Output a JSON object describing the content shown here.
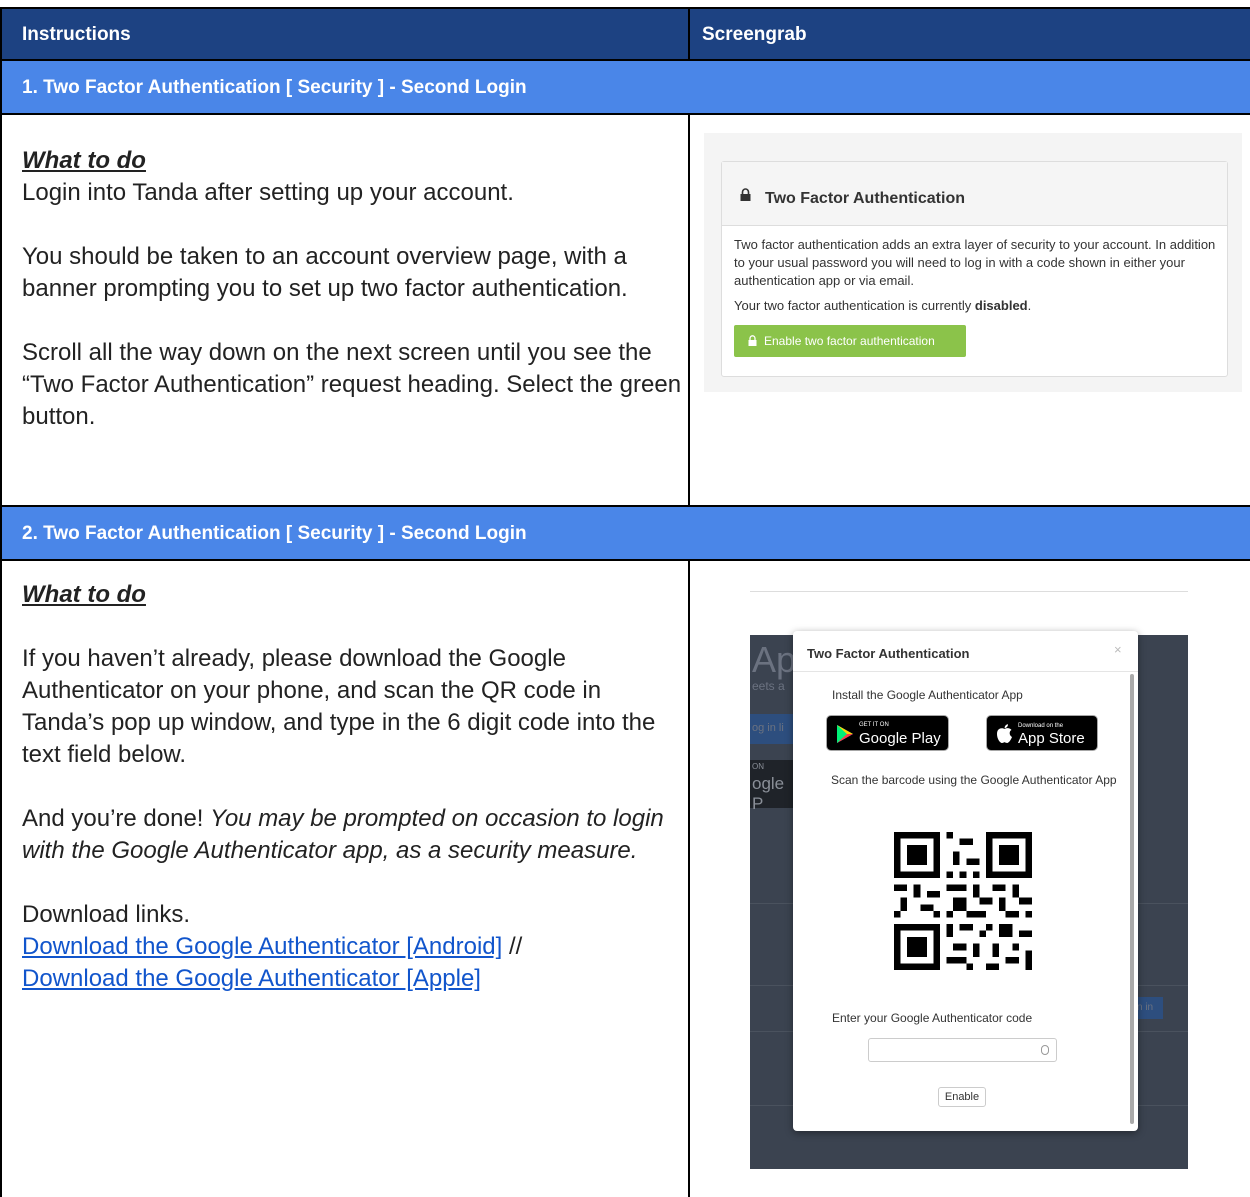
{
  "header": {
    "col1": "Instructions",
    "col2": "Screengrab"
  },
  "sections": [
    {
      "title": "1. Two Factor Authentication [ Security ] - Second Login",
      "what_to_do": "What to do",
      "p1": "Login into Tanda after setting up your account.",
      "p2": "You should be taken to an account overview page, with a banner prompting you to set up two factor authentication.",
      "p3": "Scroll all the way down on the next screen until you see the “Two Factor Authentication” request heading. Select the green button.",
      "screengrab": {
        "card_title": "Two Factor Authentication",
        "body": "Two factor authentication adds an extra layer of security to your account. In addition to your usual password you will need to log in with a code shown in either your authentication app or via email.",
        "status_prefix": "Your two factor authentication is currently ",
        "status_value": "disabled",
        "status_suffix": ".",
        "button_label": "Enable two factor authentication",
        "icons": [
          "lock-icon"
        ]
      }
    },
    {
      "title": "2. Two Factor Authentication [ Security ] - Second Login",
      "what_to_do": "What to do",
      "p1": "If you haven’t already, please download the Google Authenticator on your phone, and scan the QR code in Tanda’s pop up window, and type in the 6 digit code into the text field below.",
      "p2_prefix": "And you’re done! ",
      "p2_italic": "You may be prompted on occasion to login with the Google Authenticator app, as a security measure.",
      "p3": "Download links.",
      "link_android": "Download the Google Authenticator [Android]",
      "link_sep": " //",
      "link_apple": "Download the Google Authenticator [Apple]",
      "screengrab": {
        "bg_title_fragment": "App",
        "bg_sub_fragment": "eets a",
        "bg_button_fragment": "og in li",
        "bg_store_small": "ON",
        "bg_store_fragment": "ogle P",
        "bg_right_button_fragment": "n in",
        "modal_title": "Two Factor Authentication",
        "close": "×",
        "install_label": "Install the Google Authenticator App",
        "google_play_small": "GET IT ON",
        "google_play_big": "Google Play",
        "app_store_small": "Download on the",
        "app_store_big": "App Store",
        "scan_label": "Scan the barcode using the Google Authenticator App",
        "enter_label": "Enter your Google Authenticator code",
        "code_value": "",
        "enable_label": "Enable",
        "icons": [
          "google-play-icon",
          "apple-icon",
          "qr-code",
          "close-icon"
        ]
      }
    }
  ]
}
